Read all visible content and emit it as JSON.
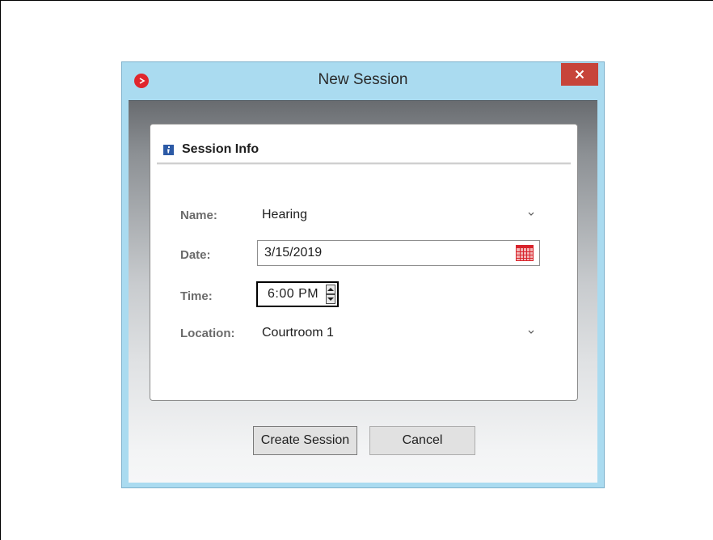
{
  "window": {
    "title": "New Session"
  },
  "panel": {
    "header": "Session Info"
  },
  "form": {
    "name_label": "Name:",
    "name_value": "Hearing",
    "date_label": "Date:",
    "date_value": "3/15/2019",
    "time_label": "Time:",
    "time_value": "6:00 PM",
    "location_label": "Location:",
    "location_value": "Courtroom 1"
  },
  "buttons": {
    "create_label": "Create Session",
    "cancel_label": "Cancel"
  },
  "icons": {
    "app": "app-logo-icon",
    "close": "close-icon",
    "info": "info-icon",
    "calendar": "calendar-icon",
    "chevron": "chevron-down-icon",
    "spin_up": "spin-up-icon",
    "spin_down": "spin-down-icon"
  },
  "colors": {
    "titlebar": "#aadbf0",
    "close_button": "#c7443a",
    "app_icon": "#e0262d",
    "calendar": "#d8242c"
  }
}
